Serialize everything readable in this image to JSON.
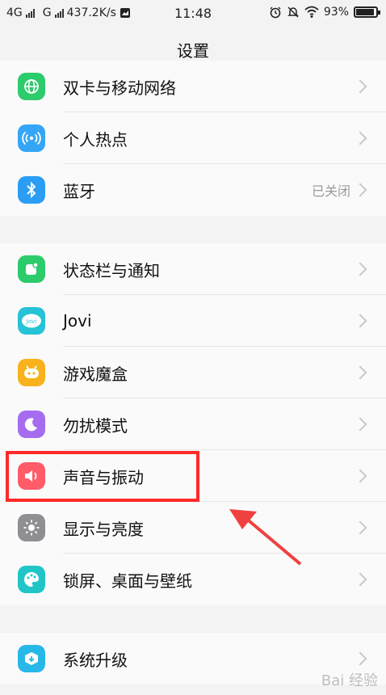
{
  "status": {
    "net1": "4G",
    "net2": "G",
    "speed": "437.2K/s",
    "time": "11:48",
    "battery": "93%",
    "battery_level": 0.93
  },
  "header": {
    "title": "设置"
  },
  "groups": [
    {
      "items": [
        {
          "label": "双卡与移动网络",
          "icon": "globe-icon",
          "color": "#2ccb6b"
        },
        {
          "label": "个人热点",
          "icon": "hotspot-icon",
          "color": "#34a6f5"
        },
        {
          "label": "蓝牙",
          "icon": "bluetooth-icon",
          "color": "#2b9df5",
          "value": "已关闭"
        }
      ]
    },
    {
      "items": [
        {
          "label": "状态栏与通知",
          "icon": "notification-icon",
          "color": "#2ccb6b"
        },
        {
          "label": "Jovi",
          "icon": "jovi-icon",
          "color": "#26c2d5",
          "icon_text": "Jovi"
        },
        {
          "label": "游戏魔盒",
          "icon": "game-box-icon",
          "color": "#f7b21c"
        },
        {
          "label": "勿扰模式",
          "icon": "moon-icon",
          "color": "#a66cf0"
        },
        {
          "label": "声音与振动",
          "icon": "speaker-icon",
          "color": "#ff5c68"
        },
        {
          "label": "显示与亮度",
          "icon": "brightness-icon",
          "color": "#8e8e93"
        },
        {
          "label": "锁屏、桌面与壁纸",
          "icon": "palette-icon",
          "color": "#21c5c8"
        }
      ]
    },
    {
      "items": [
        {
          "label": "系统升级",
          "icon": "system-update-icon",
          "color": "#27b8e8"
        }
      ]
    }
  ],
  "watermark": "Bai 经验"
}
